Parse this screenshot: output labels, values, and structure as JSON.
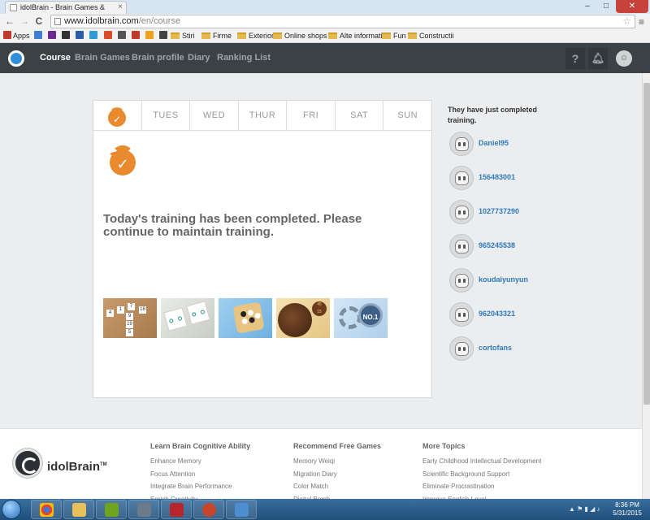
{
  "browser": {
    "tab_title": "idolBrain - Brain Games &",
    "url_host": "www.idolbrain.com",
    "url_path": "/en/course",
    "back_glyph": "←",
    "forward_glyph": "→",
    "reload_glyph": "C",
    "bookmarks": [
      {
        "label": "Apps",
        "color": "#c0392b"
      },
      {
        "label": "",
        "color": "#3f7fd1"
      },
      {
        "label": "",
        "color": "#6b2a8e"
      },
      {
        "label": "",
        "color": "#333333"
      },
      {
        "label": "",
        "color": "#2a5ca8"
      },
      {
        "label": "",
        "color": "#2f9ad6"
      },
      {
        "label": "",
        "color": "#d94c2a"
      },
      {
        "label": "",
        "color": "#555555"
      },
      {
        "label": "",
        "color": "#c0392b"
      },
      {
        "label": "",
        "color": "#f0a21b"
      },
      {
        "label": "",
        "color": "#444444"
      },
      {
        "label": "Stiri",
        "folder": true
      },
      {
        "label": "Firme",
        "folder": true
      },
      {
        "label": "Exterior",
        "folder": true
      },
      {
        "label": "Online shops",
        "folder": true
      },
      {
        "label": "Alte informatii",
        "folder": true
      },
      {
        "label": "Fun",
        "folder": true
      },
      {
        "label": "Constructii",
        "folder": true
      }
    ]
  },
  "site": {
    "nav": [
      {
        "label": "Course",
        "active": true
      },
      {
        "label": "Brain Games",
        "active": false
      },
      {
        "label": "Brain profile",
        "active": false
      },
      {
        "label": "Diary",
        "active": false
      },
      {
        "label": "Ranking List",
        "active": false
      }
    ],
    "help_glyph": "?",
    "accent": "#e98a2e",
    "link_color": "#2f7bbf"
  },
  "week": {
    "days": [
      "",
      "TUES",
      "WED",
      "THUR",
      "FRI",
      "SAT",
      "SUN"
    ],
    "completed_day_index": 0
  },
  "main": {
    "message": "Today's training has been completed. Please continue to maintain training.",
    "game_tiles": [
      {
        "numbers": [
          "4",
          "1",
          "7",
          "18",
          "9",
          "19",
          "5"
        ]
      },
      {},
      {},
      {
        "badge_top": "45",
        "badge_bottom": "15"
      },
      {
        "badge": "NO.1"
      }
    ]
  },
  "sidebar": {
    "title": "They have just completed training.",
    "users": [
      "Daniel95",
      "156483001",
      "1027737290",
      "965245538",
      "koudaiyunyun",
      "962043321",
      "cortofans"
    ]
  },
  "footer": {
    "brand": "idolBrain",
    "brand_mark": "TM",
    "columns": [
      {
        "title": "Learn Brain Cognitive Ability",
        "items": [
          "Enhance Memory",
          "Focus Attention",
          "Integrate Brain Performance",
          "Enrich Creativity"
        ]
      },
      {
        "title": "Recommend Free Games",
        "items": [
          "Memory Weiqi",
          "Migration Diary",
          "Color Match",
          "Digital Bomb"
        ]
      },
      {
        "title": "More Topics",
        "items": [
          "Early Childhood Intellectual Development",
          "Scientific Background Support",
          "Eliminate Procrastination",
          "Improve English Level"
        ]
      }
    ]
  },
  "taskbar": {
    "time": "8:36 PM",
    "date": "5/31/2015"
  }
}
